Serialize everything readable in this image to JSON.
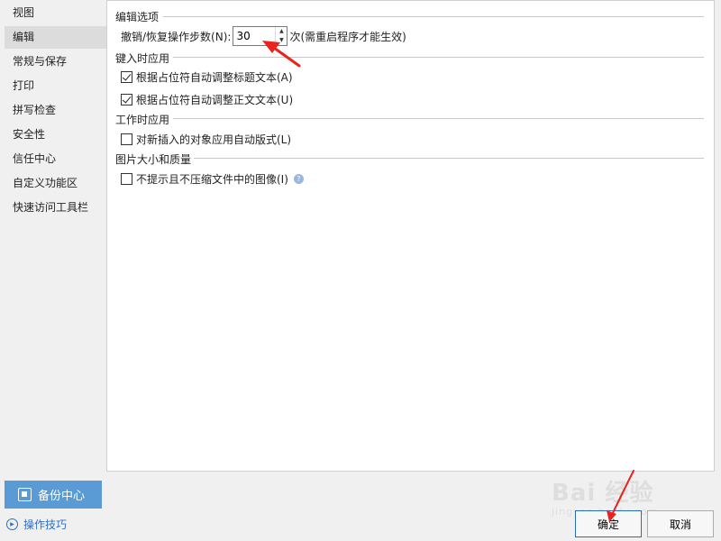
{
  "sidebar": {
    "items": [
      {
        "label": "视图",
        "active": false
      },
      {
        "label": "编辑",
        "active": true
      },
      {
        "label": "常规与保存",
        "active": false
      },
      {
        "label": "打印",
        "active": false
      },
      {
        "label": "拼写检查",
        "active": false
      },
      {
        "label": "安全性",
        "active": false
      },
      {
        "label": "信任中心",
        "active": false
      },
      {
        "label": "自定义功能区",
        "active": false
      },
      {
        "label": "快速访问工具栏",
        "active": false
      }
    ],
    "backup_label": "备份中心",
    "tips_label": "操作技巧"
  },
  "editing": {
    "title": "编辑选项",
    "undo_label": "撤销/恢复操作步数(N):",
    "undo_value": "30",
    "undo_suffix": "次(需重启程序才能生效)"
  },
  "typing": {
    "title": "键入时应用",
    "options": [
      {
        "label": "根据占位符自动调整标题文本(A)",
        "checked": true
      },
      {
        "label": "根据占位符自动调整正文文本(U)",
        "checked": true
      }
    ]
  },
  "working": {
    "title": "工作时应用",
    "options": [
      {
        "label": "对新插入的对象应用自动版式(L)",
        "checked": false
      }
    ]
  },
  "image_quality": {
    "title": "图片大小和质量",
    "options": [
      {
        "label": "不提示且不压缩文件中的图像(I)",
        "checked": false
      }
    ],
    "help_icon": "?"
  },
  "footer": {
    "ok_label": "确定",
    "cancel_label": "取消"
  },
  "watermark": {
    "main": "Bai 经验",
    "sub": "jingyan.baidu.com"
  },
  "colors": {
    "accent": "#5b9bd5",
    "annotation_arrow": "#e8241d"
  }
}
